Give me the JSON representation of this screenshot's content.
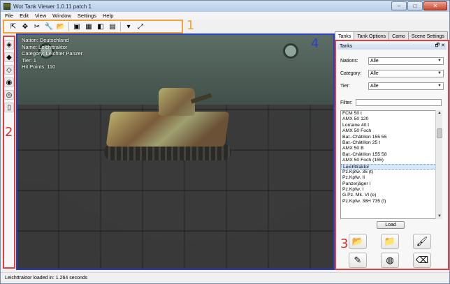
{
  "window": {
    "title": "Wot Tank Viewer 1.0.11 patch 1",
    "controls": {
      "minimize": "–",
      "maximize": "□",
      "close": "✕"
    }
  },
  "menu": [
    "File",
    "Edit",
    "View",
    "Window",
    "Settings",
    "Help"
  ],
  "toolbar": {
    "buttons": [
      {
        "name": "select-tool-icon",
        "glyph": "⇱"
      },
      {
        "name": "move-tool-icon",
        "glyph": "✥"
      },
      {
        "name": "tools-icon",
        "glyph": "✂"
      },
      {
        "name": "wrench-icon",
        "glyph": "🔧"
      },
      {
        "name": "open-folder-icon",
        "glyph": "📂"
      },
      {
        "name": "view-cube-icon",
        "glyph": "▣"
      },
      {
        "name": "wireframe-cube-icon",
        "glyph": "▦"
      },
      {
        "name": "textured-cube-icon",
        "glyph": "◧"
      },
      {
        "name": "notes-icon",
        "glyph": "▤"
      },
      {
        "name": "dropdown-icon",
        "glyph": "▾"
      },
      {
        "name": "fullscreen-icon",
        "glyph": "⤢"
      }
    ]
  },
  "callouts": {
    "one": "1",
    "two": "2",
    "three": "3",
    "four": "4"
  },
  "left_tools": [
    {
      "name": "tank-front-icon",
      "glyph": "◈"
    },
    {
      "name": "tank-side-icon",
      "glyph": "◆"
    },
    {
      "name": "tank-armor-icon",
      "glyph": "◇"
    },
    {
      "name": "tank-color-icon",
      "glyph": "◉"
    },
    {
      "name": "tank-outline-icon",
      "glyph": "◎"
    },
    {
      "name": "page-icon",
      "glyph": "▯"
    }
  ],
  "info": {
    "nation": "Nation: Deutschland",
    "name": "Name: Leichttraktor",
    "category": "Category: Leichter Panzer",
    "tier": "Tier: 1",
    "hitpoints": "Hit Points: 110"
  },
  "right_panel": {
    "tabs": [
      "Tanks",
      "Tank Options",
      "Camo",
      "Scene Settings"
    ],
    "header": "Tanks",
    "header_icons": "🗗 ✕",
    "nations": {
      "label": "Nations:",
      "value": "Alle"
    },
    "category": {
      "label": "Category:",
      "value": "Alle"
    },
    "tier": {
      "label": "Tier:",
      "value": "Alle"
    },
    "filter_label": "Filter:",
    "tanks": [
      "FCM 50 t",
      "AMX 50 120",
      "Lorraine 40 t",
      "AMX 50 Foch",
      "Bat.-Châtillon 155 55",
      "Bat.-Châtillon 25 t",
      "AMX 50 B",
      "Bat.-Châtillon 155 58",
      "AMX 50 Foch (155)",
      "Leichttraktor",
      "Pz.Kpfw. 35 (t)",
      "Pz.Kpfw. II",
      "Panzerjäger I",
      "Pz.Kpfw. I",
      "G.Pz. Mk. VI (e)",
      "Pz.Kpfw. 38H 735 (f)"
    ],
    "selected_index": 9,
    "load_label": "Load",
    "icons": [
      {
        "name": "open-folder-big-icon",
        "glyph": "📂"
      },
      {
        "name": "add-folder-icon",
        "glyph": "📁"
      },
      {
        "name": "paint-icon",
        "glyph": "🖌"
      },
      {
        "name": "brush-tool-icon",
        "glyph": "✎"
      },
      {
        "name": "checker-ball-icon",
        "glyph": "◍"
      },
      {
        "name": "eraser-icon",
        "glyph": "⌫"
      }
    ]
  },
  "status": "Leichttraktor loaded in: 1.264 seconds"
}
